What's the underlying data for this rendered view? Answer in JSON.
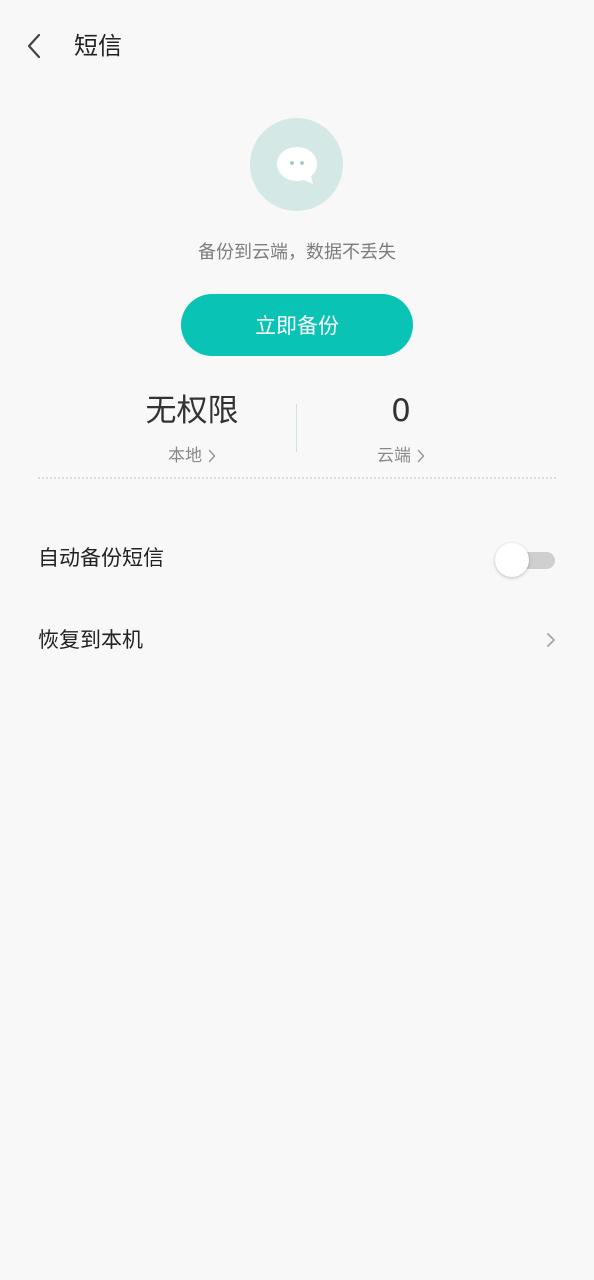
{
  "header": {
    "title": "短信",
    "back_icon": "chevron-left-icon"
  },
  "hero": {
    "icon": "message-bubble-icon",
    "subtitle": "备份到云端，数据不丢失",
    "backup_button_label": "立即备份"
  },
  "stats": {
    "local": {
      "value": "无权限",
      "label": "本地"
    },
    "cloud": {
      "value": "0",
      "label": "云端"
    }
  },
  "settings": {
    "auto_backup": {
      "label": "自动备份短信",
      "enabled": false
    },
    "restore": {
      "label": "恢复到本机"
    }
  },
  "colors": {
    "accent": "#09c3b4",
    "icon_bg": "#d4e8e6",
    "background": "#f8f8f8"
  }
}
